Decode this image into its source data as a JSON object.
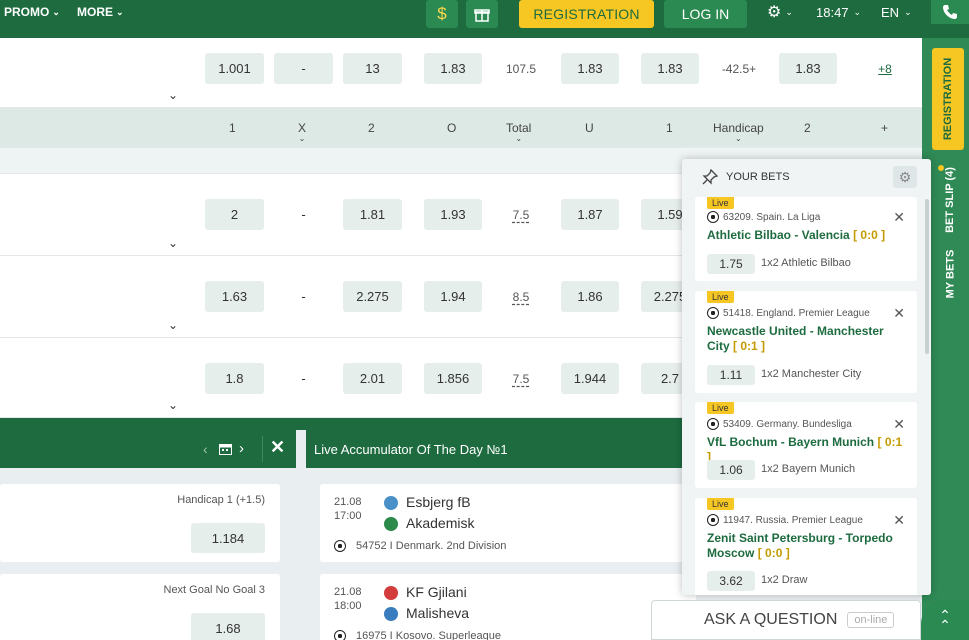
{
  "topbar": {
    "promo_label": "PROMO",
    "more_label": "MORE",
    "dollar_icon": "$",
    "gift_icon": "gift-icon",
    "registration_label": "REGISTRATION",
    "login_label": "LOG IN",
    "time": "18:47",
    "language": "EN"
  },
  "odds_header": {
    "c1": "1",
    "cx": "X",
    "c2": "2",
    "o": "O",
    "total": "Total",
    "u": "U",
    "h1": "1",
    "handicap": "Handicap",
    "h2": "2",
    "plus": "+"
  },
  "rows": [
    {
      "v1": "1.001",
      "vx": "-",
      "v2": "13",
      "o": "1.83",
      "total": "107.5",
      "u": "1.83",
      "h1": "1.83",
      "hcp": "-42.5+",
      "h2": "1.83",
      "more": "+8"
    },
    {
      "v1": "2",
      "vx": "-",
      "v2": "1.81",
      "o": "1.93",
      "total": "7.5",
      "u": "1.87",
      "h1": "1.59"
    },
    {
      "v1": "1.63",
      "vx": "-",
      "v2": "2.275",
      "o": "1.94",
      "total": "8.5",
      "u": "1.86",
      "h1": "2.275"
    },
    {
      "v1": "1.8",
      "vx": "-",
      "v2": "2.01",
      "o": "1.856",
      "total": "7.5",
      "u": "1.944",
      "h1": "2.7"
    }
  ],
  "left_panel": {
    "cards": [
      {
        "label": "Handicap 1 (+1.5)",
        "odd": "1.184"
      },
      {
        "label": "Next Goal No Goal 3",
        "odd": "1.68"
      }
    ]
  },
  "accumulator": {
    "title": "Live Accumulator Of The Day №1",
    "matches": [
      {
        "date": "21.08",
        "time": "17:00",
        "team1": "Esbjerg fB",
        "team2": "Akademisk",
        "league": "54752 I Denmark. 2nd Division"
      },
      {
        "date": "21.08",
        "time": "18:00",
        "team1": "KF Gjilani",
        "team2": "Malisheva",
        "league": "16975 I Kosovo. Superleague"
      }
    ]
  },
  "rail": {
    "registration": "REGISTRATION",
    "bet_slip": "BET SLIP (4)",
    "my_bets": "MY BETS"
  },
  "bet_slip": {
    "title": "YOUR BETS",
    "live_label": "Live",
    "bets": [
      {
        "league": "63209. Spain. La Liga",
        "match": "Athletic Bilbao - Valencia",
        "score": "[ 0:0 ]",
        "odd": "1.75",
        "pick": "1x2 Athletic Bilbao"
      },
      {
        "league": "51418. England. Premier League",
        "match": "Newcastle United - Manchester City",
        "score": "[ 0:1 ]",
        "odd": "1.11",
        "pick": "1x2 Manchester City"
      },
      {
        "league": "53409. Germany. Bundesliga",
        "match": "VfL Bochum - Bayern Munich",
        "score": "[ 0:1 ]",
        "odd": "1.06",
        "pick": "1x2 Bayern Munich"
      },
      {
        "league": "11947. Russia. Premier League",
        "match": "Zenit Saint Petersburg - Torpedo Moscow",
        "score": "[ 0:0 ]",
        "odd": "3.62",
        "pick": "1x2 Draw"
      }
    ]
  },
  "ask": {
    "label": "ASK A QUESTION",
    "status": "on-line"
  },
  "colors": {
    "brand": "#1d6b3f",
    "accent": "#f6c623"
  }
}
